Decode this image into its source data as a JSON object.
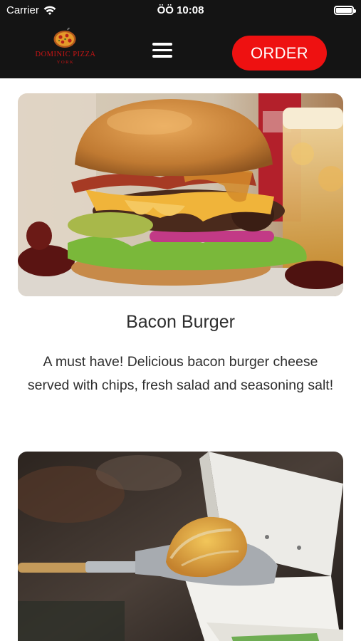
{
  "status_bar": {
    "carrier": "Carrier",
    "time": "ÖÖ 10:08"
  },
  "header": {
    "brand_name": "DOMINIC PIZZA",
    "brand_sub": "YORK",
    "menu_icon": "hamburger-menu-icon",
    "order_label": "ORDER",
    "colors": {
      "background": "#141414",
      "accent": "#ee1111"
    }
  },
  "items": [
    {
      "title": "Bacon Burger",
      "description": "A must have! Delicious bacon burger cheese served with chips, fresh salad and seasoning salt!",
      "image": "bacon-burger-photo"
    },
    {
      "image": "calzone-on-pizza-peel-photo"
    }
  ]
}
